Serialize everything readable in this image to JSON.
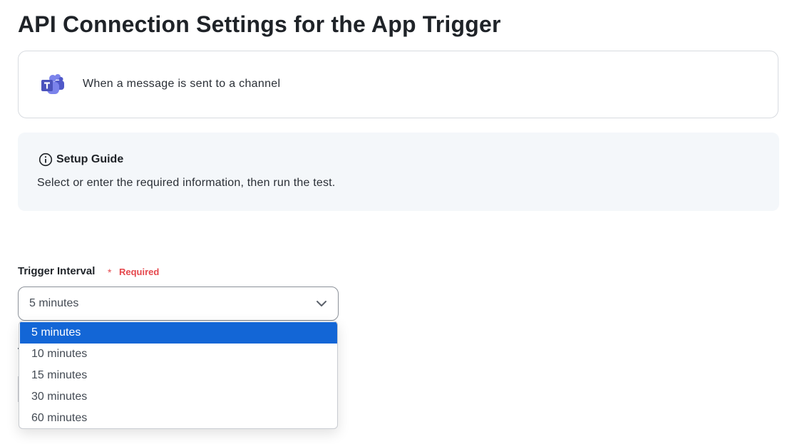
{
  "page": {
    "title": "API Connection Settings for the App Trigger"
  },
  "trigger": {
    "app_icon": "teams-icon",
    "label": "When a message is sent to a channel"
  },
  "setup_guide": {
    "icon": "info-icon",
    "title": "Setup Guide",
    "description": "Select or enter the required information, then run the test."
  },
  "trigger_interval": {
    "label": "Trigger Interval",
    "required_mark": "*",
    "required_text": "Required",
    "value": "5 minutes",
    "options": [
      "5 minutes",
      "10 minutes",
      "15 minutes",
      "30 minutes",
      "60 minutes"
    ],
    "selected_index": 0
  },
  "colors": {
    "selected_bg": "#1366d6",
    "required": "#e5484d",
    "teams_purple": "#5059c9"
  }
}
